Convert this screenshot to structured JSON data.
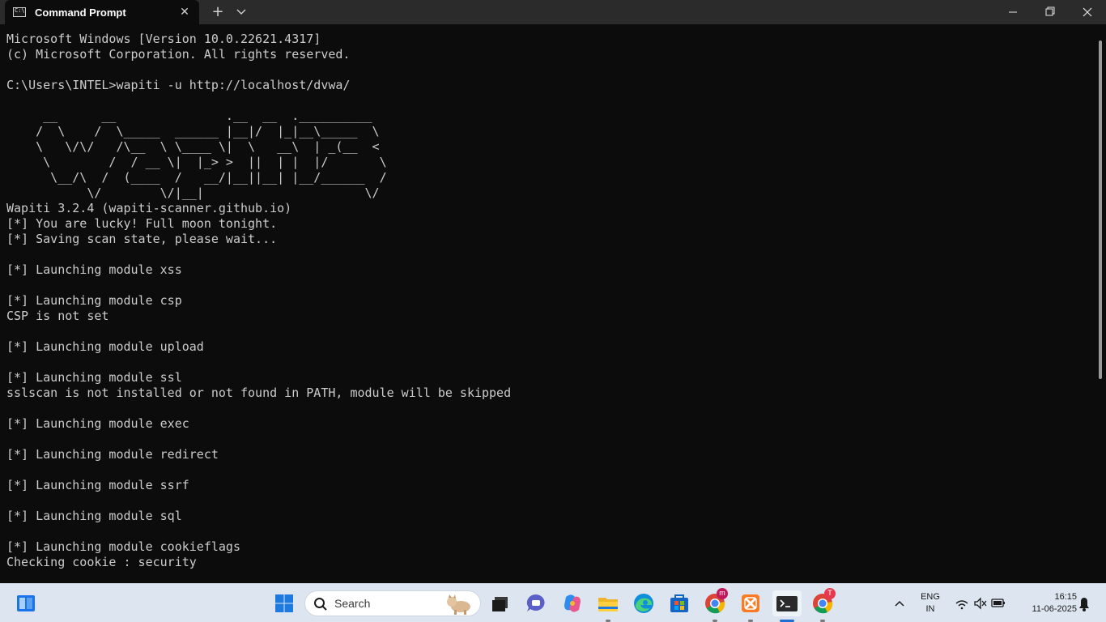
{
  "window": {
    "tab_title": "Command Prompt",
    "new_tab_symbol": "+",
    "close_symbol": "✕"
  },
  "terminal": {
    "lines": [
      "Microsoft Windows [Version 10.0.22621.4317]",
      "(c) Microsoft Corporation. All rights reserved.",
      "",
      "C:\\Users\\INTEL>wapiti -u http://localhost/dvwa/",
      "",
      "     __      __               .__  __  .__________",
      "    /  \\    /  \\_____  ______ |__|/  |_|__\\_____  \\",
      "    \\   \\/\\/   /\\__  \\ \\____ \\|  \\   __\\  | _(__  <",
      "     \\        /  / __ \\|  |_> >  ||  | |  |/       \\",
      "      \\__/\\  /  (____  /   __/|__||__| |__/______  /",
      "           \\/        \\/|__|                      \\/",
      "Wapiti 3.2.4 (wapiti-scanner.github.io)",
      "[*] You are lucky! Full moon tonight.",
      "[*] Saving scan state, please wait...",
      "",
      "[*] Launching module xss",
      "",
      "[*] Launching module csp",
      "CSP is not set",
      "",
      "[*] Launching module upload",
      "",
      "[*] Launching module ssl",
      "sslscan is not installed or not found in PATH, module will be skipped",
      "",
      "[*] Launching module exec",
      "",
      "[*] Launching module redirect",
      "",
      "[*] Launching module ssrf",
      "",
      "[*] Launching module sql",
      "",
      "[*] Launching module cookieflags",
      "Checking cookie : security"
    ]
  },
  "taskbar": {
    "search_label": "Search",
    "lang_line1": "ENG",
    "lang_line2": "IN",
    "time": "16:15",
    "date": "11-06-2025",
    "chrome_badge_1": "m",
    "chrome_badge_2": "T",
    "icons": [
      "widgets-icon",
      "start-icon",
      "search-icon",
      "task-view-icon",
      "teams-chat-icon",
      "copilot-icon",
      "file-explorer-icon",
      "edge-icon",
      "store-icon",
      "chrome-icon",
      "xampp-icon",
      "terminal-icon",
      "chrome-icon"
    ]
  },
  "colors": {
    "terminal_bg": "#0c0c0c",
    "terminal_fg": "#cccccc",
    "titlebar_bg": "#2b2b2b",
    "taskbar_bg": "#dde6f0"
  }
}
